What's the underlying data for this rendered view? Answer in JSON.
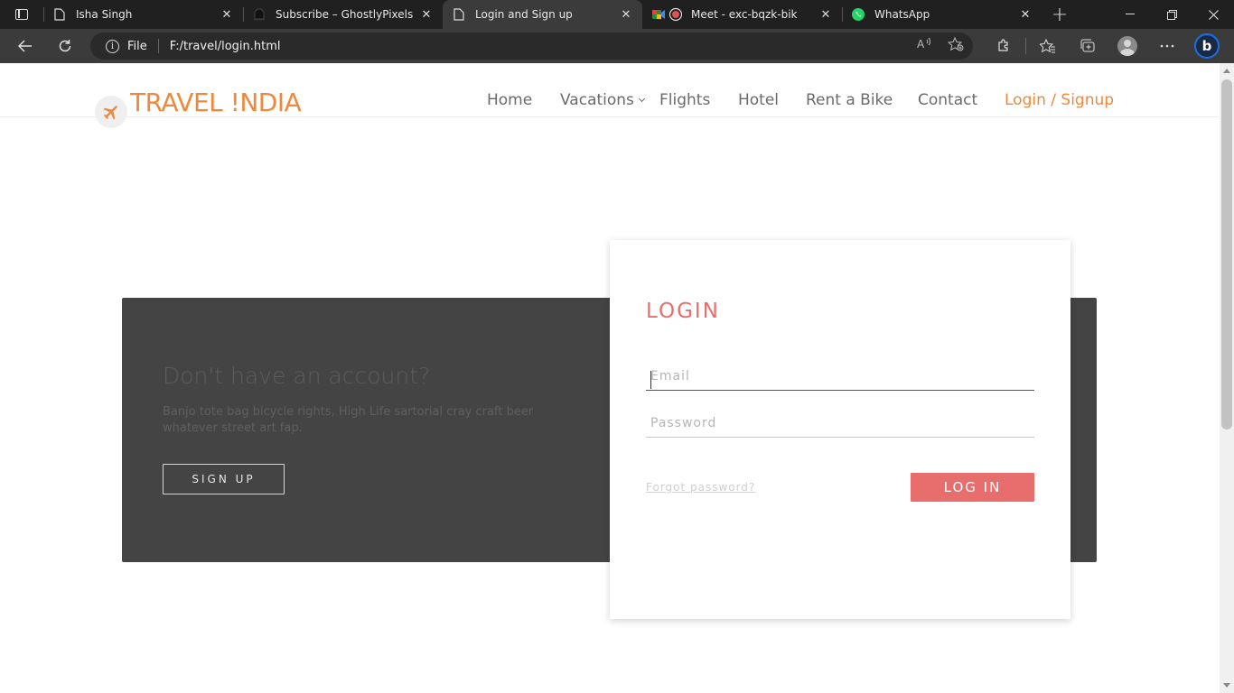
{
  "browser": {
    "tabs": [
      {
        "title": "Isha Singh",
        "icon": "page-icon"
      },
      {
        "title": "Subscribe – GhostlyPixels",
        "icon": "ghost-icon"
      },
      {
        "title": "Login and Sign up",
        "icon": "page-icon",
        "active": true
      },
      {
        "title": "Meet - exc-bqzk-bik",
        "icon": "meet-icon"
      },
      {
        "title": "WhatsApp",
        "icon": "whatsapp-icon"
      }
    ],
    "tab_close": "✕",
    "new_tab": "+",
    "address": {
      "scheme_label": "File",
      "url": "F:/travel/login.html"
    }
  },
  "site": {
    "logo_text": "TRAVEL !NDIA",
    "nav": {
      "home": "Home",
      "vacations": "Vacations",
      "flights": "Flights",
      "hotel": "Hotel",
      "rent_bike": "Rent a Bike",
      "contact": "Contact",
      "login_signup": "Login / Signup"
    },
    "accent_color": "#f0883b"
  },
  "signup_panel": {
    "heading": "Don't have an account?",
    "text": "Banjo tote bag bicycle rights, High Life sartorial cray craft beer whatever street art fap.",
    "button": "SIGN UP"
  },
  "login_form": {
    "title": "LOGIN",
    "email_placeholder": "Email",
    "password_placeholder": "Password",
    "forgot_link": "Forgot password?",
    "submit": "LOG IN",
    "accent_color": "#e86e6e"
  }
}
